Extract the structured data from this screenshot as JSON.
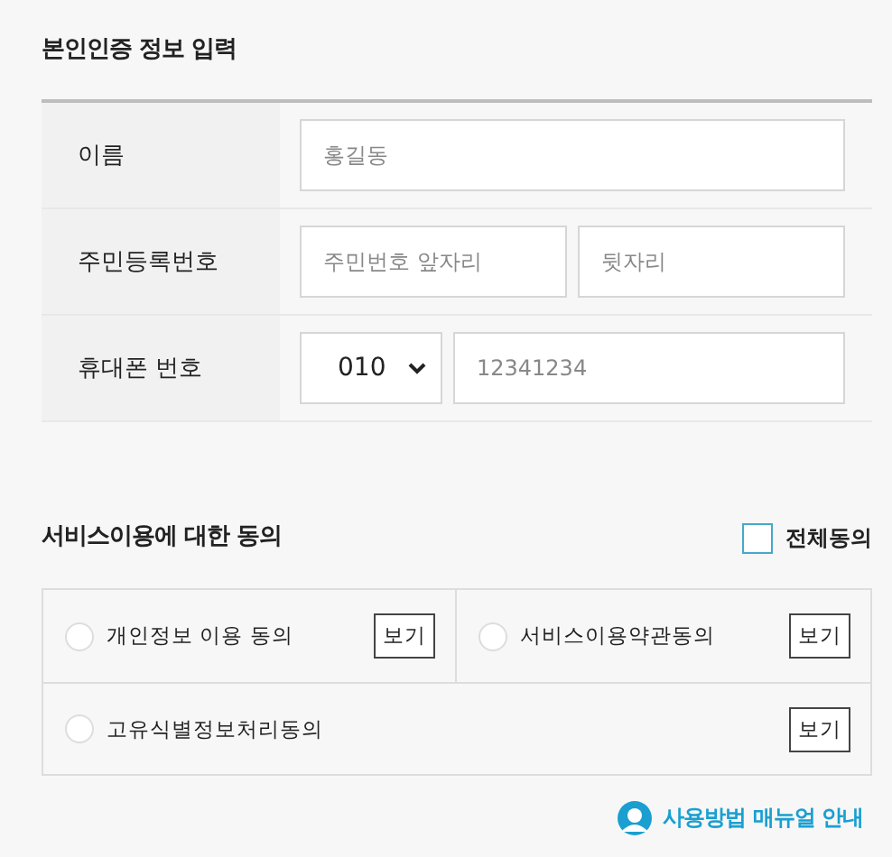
{
  "identity_section": {
    "title": "본인인증 정보 입력",
    "rows": [
      {
        "label": "이름",
        "kind": "single",
        "fields": [
          {
            "placeholder": "홍길동"
          }
        ]
      },
      {
        "label": "주민등록번호",
        "kind": "split",
        "fields": [
          {
            "placeholder": "주민번호 앞자리"
          },
          {
            "placeholder": "뒷자리"
          }
        ]
      },
      {
        "label": "휴대폰 번호",
        "kind": "phone",
        "select": {
          "value": "010"
        },
        "fields": [
          {
            "placeholder": "12341234"
          }
        ]
      }
    ]
  },
  "consent_section": {
    "title": "서비스이용에 대한 동의",
    "agree_all": {
      "label": "전체동의",
      "checked": false
    },
    "items": [
      {
        "label": "개인정보 이용 동의",
        "checked": false,
        "button": "보기"
      },
      {
        "label": "서비스이용약관동의",
        "checked": false,
        "button": "보기"
      },
      {
        "label": "고유식별정보처리동의",
        "checked": false,
        "button": "보기"
      }
    ]
  },
  "manual_link": "사용방법 매뉴얼 안내"
}
